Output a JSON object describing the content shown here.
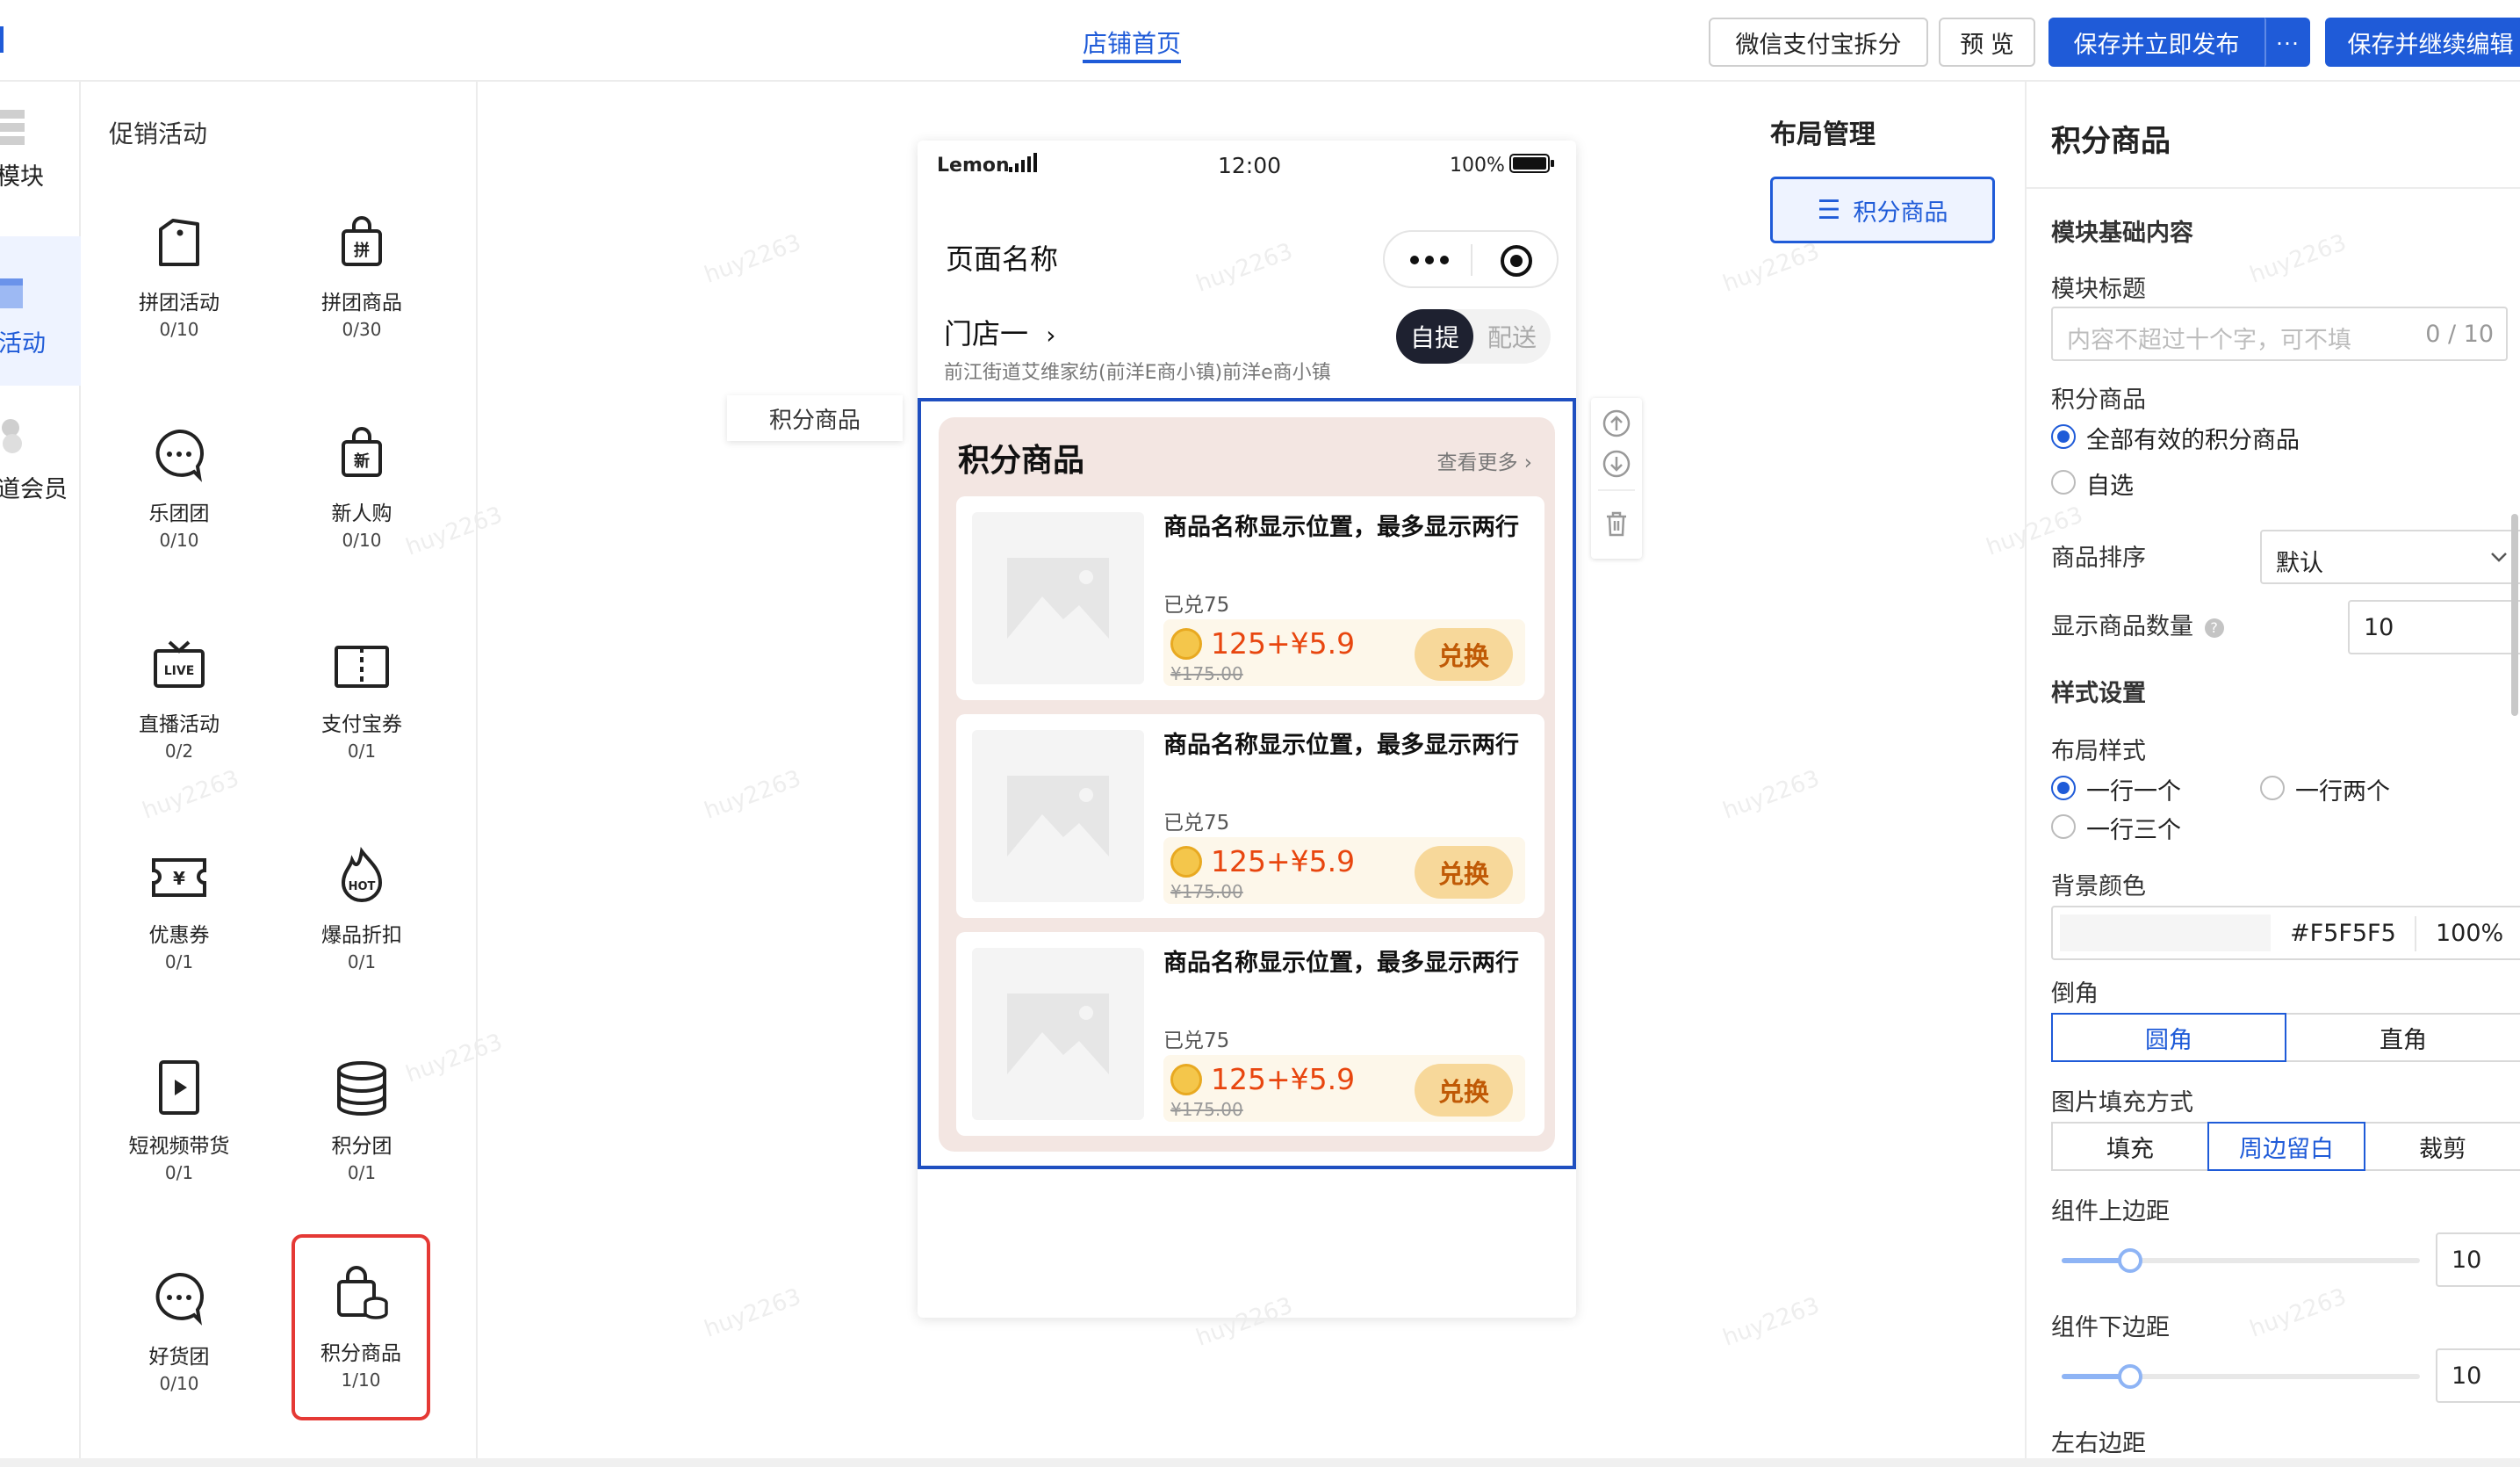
{
  "header": {
    "tab_home": "店铺首页",
    "btn_split": "微信支付宝拆分",
    "btn_preview": "预 览",
    "btn_publish": "保存并立即发布",
    "btn_more": "···",
    "btn_save_continue": "保存并继续编辑"
  },
  "nav": {
    "items": [
      {
        "label": "模块",
        "icon": "blocks-icon"
      },
      {
        "label": "活动",
        "icon": "gift-icon",
        "active": true
      },
      {
        "label": "道会员",
        "icon": "member-icon"
      }
    ]
  },
  "components": {
    "title": "促销活动",
    "items": [
      {
        "name": "拼团活动",
        "count": "0/10",
        "icon": "group-tag-icon"
      },
      {
        "name": "拼团商品",
        "count": "0/30",
        "icon": "group-bag-icon"
      },
      {
        "name": "乐团团",
        "count": "0/10",
        "icon": "chat-group-icon"
      },
      {
        "name": "新人购",
        "count": "0/10",
        "icon": "new-bag-icon"
      },
      {
        "name": "直播活动",
        "count": "0/2",
        "icon": "live-tv-icon"
      },
      {
        "name": "支付宝券",
        "count": "0/1",
        "icon": "ticket-book-icon"
      },
      {
        "name": "优惠券",
        "count": "0/1",
        "icon": "coupon-icon"
      },
      {
        "name": "爆品折扣",
        "count": "0/1",
        "icon": "hot-fire-icon"
      },
      {
        "name": "短视频带货",
        "count": "0/1",
        "icon": "video-icon"
      },
      {
        "name": "积分团",
        "count": "0/1",
        "icon": "coin-stack-icon"
      },
      {
        "name": "好货团",
        "count": "0/10",
        "icon": "chat-group-icon"
      },
      {
        "name": "积分商品",
        "count": "1/10",
        "icon": "points-bag-icon",
        "selected": true
      }
    ]
  },
  "canvas": {
    "floating_label": "积分商品",
    "status": {
      "carrier": "Lemon",
      "time": "12:00",
      "battery": "100%"
    },
    "page_title": "页面名称",
    "store_name": "门店一",
    "store_addr": "前江街道艾维家纺(前洋E商小镇)前洋e商小镇",
    "pickup_on": "自提",
    "pickup_off": "配送",
    "module": {
      "title": "积分商品",
      "more": "查看更多 ›",
      "cards": [
        {
          "title": "商品名称显示位置，最多显示两行",
          "sold": "已兑75",
          "price": "125+¥5.9",
          "orig_price": "¥175.00",
          "action": "兑换"
        },
        {
          "title": "商品名称显示位置，最多显示两行",
          "sold": "已兑75",
          "price": "125+¥5.9",
          "orig_price": "¥175.00",
          "action": "兑换"
        },
        {
          "title": "商品名称显示位置，最多显示两行",
          "sold": "已兑75",
          "price": "125+¥5.9",
          "orig_price": "¥175.00",
          "action": "兑换"
        }
      ]
    }
  },
  "layout_mgr": {
    "title": "布局管理",
    "item": "积分商品"
  },
  "settings": {
    "title": "积分商品",
    "section_basic": "模块基础内容",
    "module_title_label": "模块标题",
    "module_title_placeholder": "内容不超过十个字，可不填",
    "module_title_counter": "0 / 10",
    "goods_label": "积分商品",
    "goods_opt_all": "全部有效的积分商品",
    "goods_opt_custom": "自选",
    "sort_label": "商品排序",
    "sort_value": "默认",
    "count_label": "显示商品数量",
    "count_value": "10",
    "section_style": "样式设置",
    "layout_label": "布局样式",
    "layout_opt1": "一行一个",
    "layout_opt2": "一行两个",
    "layout_opt3": "一行三个",
    "bg_label": "背景颜色",
    "bg_hex": "#F5F5F5",
    "bg_opacity": "100%",
    "bg_color": "#F5F5F5",
    "corner_label": "倒角",
    "corner_round": "圆角",
    "corner_square": "直角",
    "fill_label": "图片填充方式",
    "fill_opt1": "填充",
    "fill_opt2": "周边留白",
    "fill_opt3": "裁剪",
    "top_margin_label": "组件上边距",
    "top_margin_value": "10",
    "bottom_margin_label": "组件下边距",
    "bottom_margin_value": "10",
    "side_margin_label": "左右边距"
  },
  "watermark": "huy2263",
  "colors": {
    "accent": "#1f5bd8",
    "selection_red": "#e53935",
    "price_red": "#e8460f"
  }
}
